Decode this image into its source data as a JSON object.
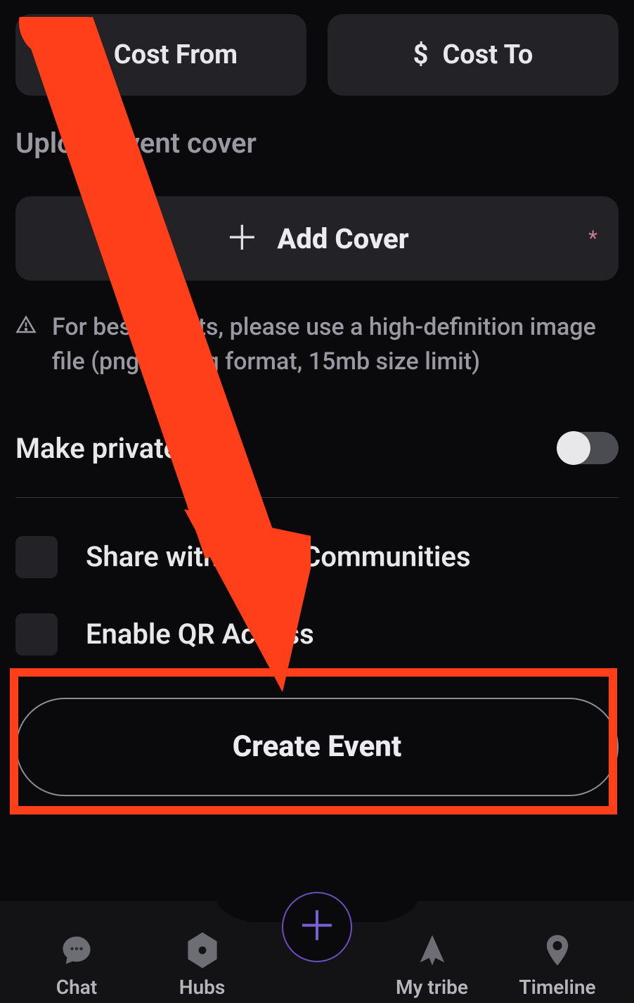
{
  "cost": {
    "currency_symbol": "$",
    "from_placeholder": "Cost From",
    "to_placeholder": "Cost To"
  },
  "cover": {
    "section_label": "Upload event cover",
    "button_label": "Add Cover",
    "required_marker": "*",
    "hint": "For best results, please use a high-definition image file (png or jpeg format, 15mb size limit)"
  },
  "privacy": {
    "toggle_label": "Make private",
    "toggle_on": false
  },
  "options": {
    "share_label": "Share with Hubs/Communities",
    "qr_label": "Enable QR Access"
  },
  "submit": {
    "button_label": "Create Event"
  },
  "nav": {
    "chat": "Chat",
    "hubs": "Hubs",
    "mytribe": "My tribe",
    "timeline": "Timeline"
  }
}
